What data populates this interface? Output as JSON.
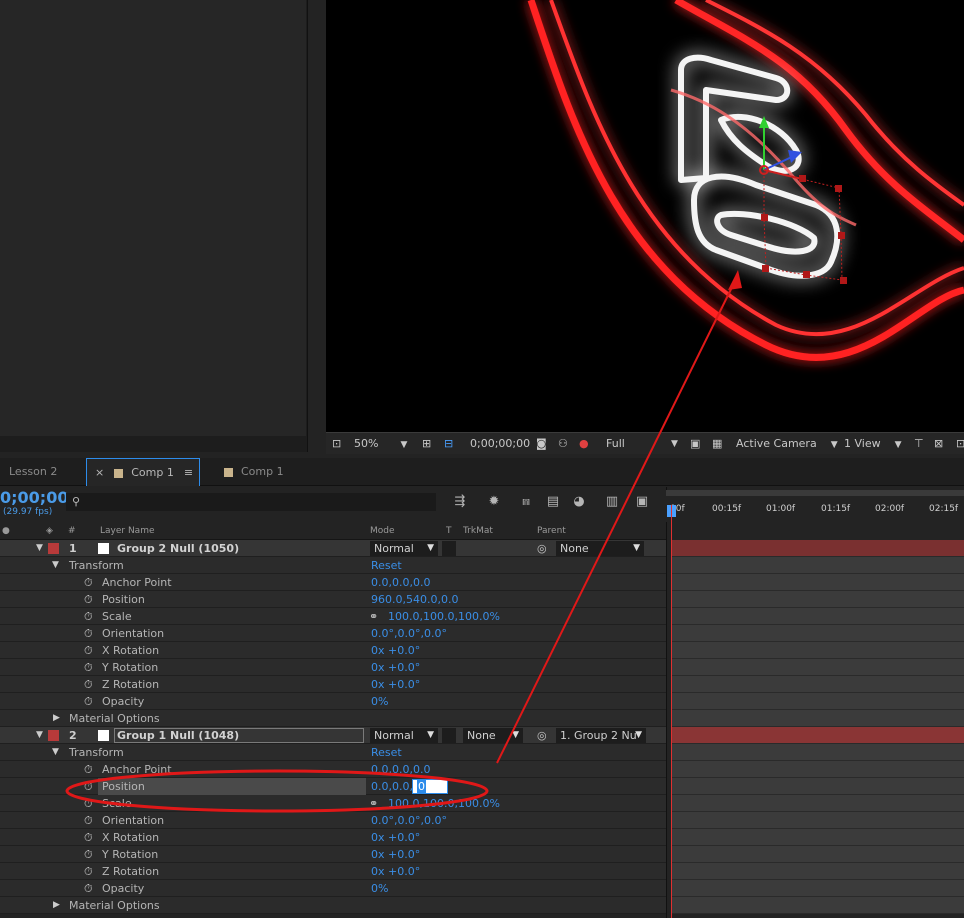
{
  "viewer_bar": {
    "zoom": "50%",
    "timecode": "0;00;00;00",
    "resolution": "Full",
    "camera": "Active Camera",
    "views": "1 View"
  },
  "tabs": [
    {
      "label": "Lesson 2"
    },
    {
      "label": "Comp 1",
      "close": "×",
      "menu": "≡"
    },
    {
      "label": "Comp 1"
    }
  ],
  "timeline": {
    "timecode": "0;00;00",
    "fps": "(29.97 fps)",
    "columns": {
      "num": "#",
      "name": "Layer Name",
      "mode": "Mode",
      "t": "T",
      "trkmat": "TrkMat",
      "parent": "Parent"
    },
    "ruler_ticks": [
      "00f",
      "00:15f",
      "01:00f",
      "01:15f",
      "02:00f",
      "02:15f"
    ]
  },
  "layers": [
    {
      "num": "1",
      "name": "Group 2 Null (1050)",
      "mode": "Normal",
      "trkmat": "",
      "parent": "None",
      "transform_label": "Transform",
      "reset": "Reset",
      "props": [
        {
          "name": "Anchor Point",
          "value": "0.0,0.0,0.0"
        },
        {
          "name": "Position",
          "value": "960.0,540.0,0.0"
        },
        {
          "name": "Scale",
          "value": "100.0,100.0,100.0%"
        },
        {
          "name": "Orientation",
          "value": "0.0°,0.0°,0.0°"
        },
        {
          "name": "X Rotation",
          "value": "0x +0.0°"
        },
        {
          "name": "Y Rotation",
          "value": "0x +0.0°"
        },
        {
          "name": "Z Rotation",
          "value": "0x +0.0°"
        },
        {
          "name": "Opacity",
          "value": "0%"
        }
      ],
      "material": "Material Options"
    },
    {
      "num": "2",
      "name": "Group 1 Null (1048)",
      "mode": "Normal",
      "trkmat": "None",
      "parent": "1. Group 2 Nu",
      "transform_label": "Transform",
      "reset": "Reset",
      "props": [
        {
          "name": "Anchor Point",
          "value": "0.0,0.0,0.0"
        },
        {
          "name": "Position",
          "value": "0.0,0.0,",
          "editing": "0"
        },
        {
          "name": "Scale",
          "value": "100.0,100.0,100.0%"
        },
        {
          "name": "Orientation",
          "value": "0.0°,0.0°,0.0°"
        },
        {
          "name": "X Rotation",
          "value": "0x +0.0°"
        },
        {
          "name": "Y Rotation",
          "value": "0x +0.0°"
        },
        {
          "name": "Z Rotation",
          "value": "0x +0.0°"
        },
        {
          "name": "Opacity",
          "value": "0%"
        }
      ],
      "material": "Material Options"
    }
  ],
  "colors": {
    "accent": "#2d8ceb",
    "value_blue": "#3a8ee6",
    "layer_red": "#b83a3a",
    "annotation_red": "#e01818"
  }
}
